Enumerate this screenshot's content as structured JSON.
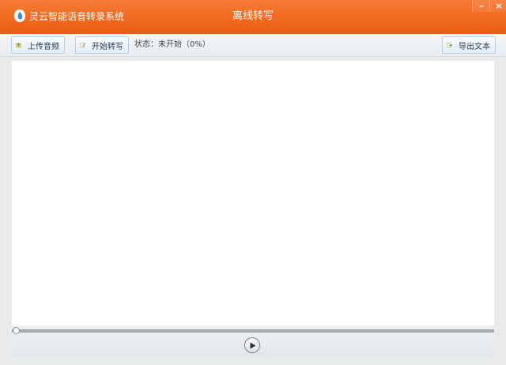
{
  "titlebar": {
    "app_name": "灵云智能语音转录系统",
    "window_title": "离线转写",
    "minimize_glyph": "–",
    "close_glyph": "×",
    "logo_icon": "app-logo-icon",
    "color": "#ef6a1f"
  },
  "toolbar": {
    "upload_label": "上传音频",
    "upload_icon": "upload-audio-icon",
    "start_label": "开始转写",
    "start_icon": "edit-transcribe-icon",
    "status_text": "状态：未开始（0%）",
    "export_label": "导出文本",
    "export_icon": "export-text-icon"
  },
  "player": {
    "progress": 0,
    "play_icon": "play-icon"
  }
}
